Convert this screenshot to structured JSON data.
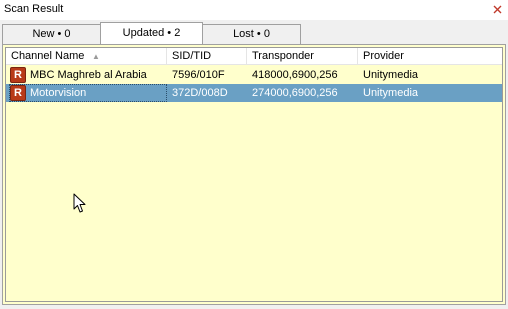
{
  "window": {
    "title": "Scan Result",
    "close_icon": "close-icon"
  },
  "tabs": [
    {
      "label": "New • 0",
      "active": false
    },
    {
      "label": "Updated • 2",
      "active": true
    },
    {
      "label": "Lost • 0",
      "active": false
    }
  ],
  "columns": {
    "channel_name": "Channel Name",
    "sid_tid": "SID/TID",
    "transponder": "Transponder",
    "provider": "Provider",
    "sort_icon": "sort-ascending-icon"
  },
  "rows": [
    {
      "icon_letter": "R",
      "channel_name": "MBC Maghreb al Arabia",
      "sid_tid": "7596/010F",
      "transponder": "418000,6900,256",
      "provider": "Unitymedia",
      "selected": false
    },
    {
      "icon_letter": "R",
      "channel_name": "Motorvision",
      "sid_tid": "372D/008D",
      "transponder": "274000,6900,256",
      "provider": "Unitymedia",
      "selected": true
    }
  ],
  "colors": {
    "list_background": "#ffffcc",
    "selection": "#6aa0c4",
    "icon": "#b83a18",
    "close": "#c0392b"
  }
}
